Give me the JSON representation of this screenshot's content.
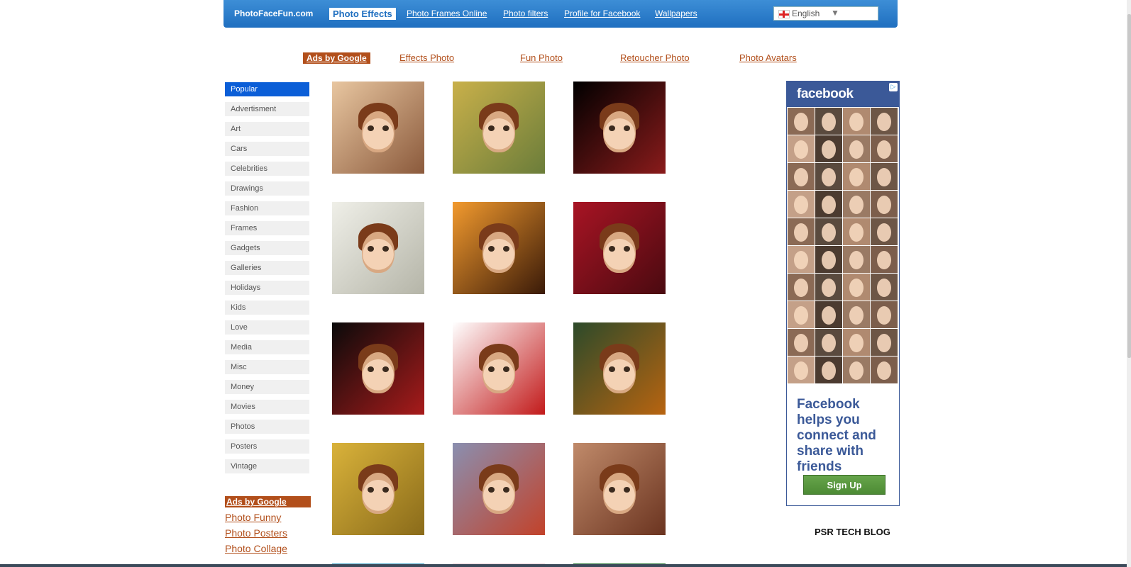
{
  "header": {
    "brand": "PhotoFaceFun.com",
    "active_tab": "Photo Effects",
    "links": [
      "Photo Frames Online",
      "Photo filters",
      "Profile for Facebook",
      "Wallpapers"
    ],
    "language": "English"
  },
  "ads_row": {
    "badge": "Ads by Google",
    "links": [
      "Effects Photo",
      "Fun Photo",
      "Retoucher Photo",
      "Photo Avatars"
    ]
  },
  "sidebar": {
    "categories": [
      "Popular",
      "Advertisment",
      "Art",
      "Cars",
      "Celebrities",
      "Drawings",
      "Fashion",
      "Frames",
      "Gadgets",
      "Galleries",
      "Holidays",
      "Kids",
      "Love",
      "Media",
      "Misc",
      "Money",
      "Movies",
      "Photos",
      "Posters",
      "Vintage"
    ],
    "active": "Popular",
    "ads_badge": "Ads by Google",
    "ad_links": [
      "Photo Funny",
      "Photo Posters",
      "Photo Collage"
    ]
  },
  "thumbnails": [
    {
      "name": "kiss-effect",
      "theme": [
        "#e8c6a0",
        "#8b5a3c"
      ]
    },
    {
      "name": "street-poster-effect",
      "theme": [
        "#c9b04a",
        "#6b7d3a"
      ]
    },
    {
      "name": "iphone-effect",
      "theme": [
        "#000000",
        "#8a1b1b"
      ]
    },
    {
      "name": "pencil-sketch-effect",
      "theme": [
        "#efefe8",
        "#b5b5a8"
      ]
    },
    {
      "name": "sunset-palms-effect",
      "theme": [
        "#f29a2e",
        "#3a1a08"
      ]
    },
    {
      "name": "valentine-heart-effect",
      "theme": [
        "#a81424",
        "#4a0a10"
      ]
    },
    {
      "name": "roses-with-love-effect",
      "theme": [
        "#0a0a0a",
        "#a81b1b"
      ]
    },
    {
      "name": "red-roses-effect",
      "theme": [
        "#ffffff",
        "#c21a1a"
      ]
    },
    {
      "name": "moon-lake-effect",
      "theme": [
        "#2c4a2a",
        "#b86410"
      ]
    },
    {
      "name": "autumn-forest-effect",
      "theme": [
        "#d9b23a",
        "#8a6b1a"
      ]
    },
    {
      "name": "graffiti-artist-effect",
      "theme": [
        "#8a8fb0",
        "#c2422a"
      ]
    },
    {
      "name": "face-in-face-effect",
      "theme": [
        "#c08a6a",
        "#6b3420"
      ]
    }
  ],
  "fb_ad": {
    "logo": "facebook",
    "tagline": "Facebook helps you connect and share with friends",
    "button": "Sign Up",
    "photo_count": 40
  },
  "blog_link": "PSR TECH BLOG"
}
